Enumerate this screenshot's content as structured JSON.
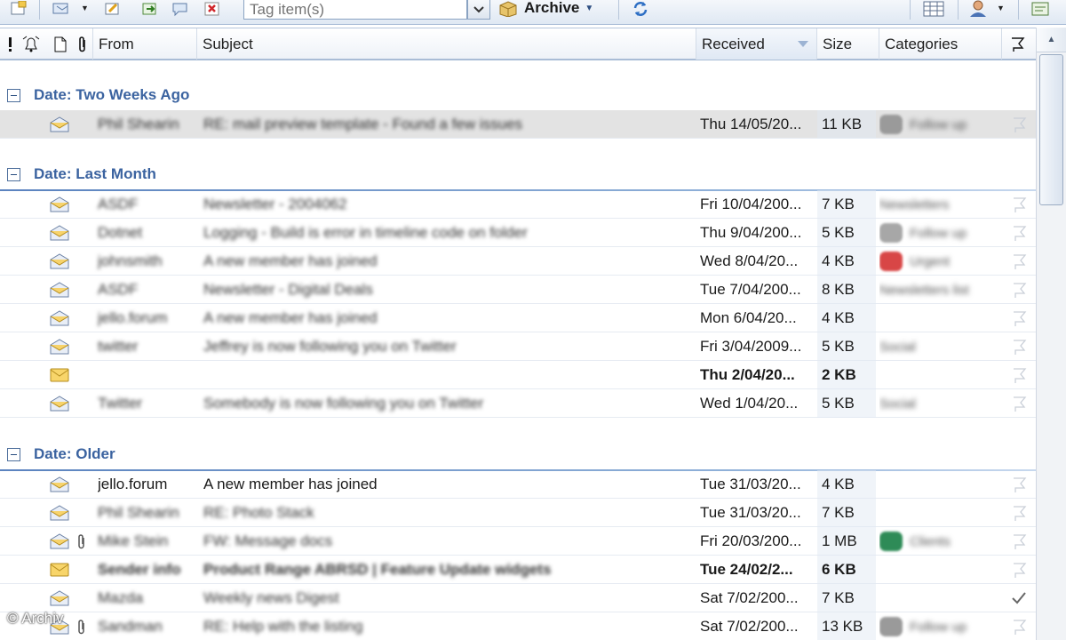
{
  "toolbar": {
    "tag_placeholder": "Tag item(s)",
    "archive_label": "Archive"
  },
  "columns": {
    "from": "From",
    "subject": "Subject",
    "received": "Received",
    "size": "Size",
    "categories": "Categories"
  },
  "groups": [
    {
      "label": "Date: Two Weeks Ago"
    },
    {
      "label": "Date: Last Month"
    },
    {
      "label": "Date: Older"
    }
  ],
  "rows": [
    {
      "from": "Phil Shearin",
      "subject": "RE: mail preview template - Found a few issues",
      "received": "Thu 14/05/20...",
      "size": "11 KB",
      "category": "Follow up",
      "cat_color": "#9a9a9a",
      "flag": "flag",
      "attach": false,
      "read": true,
      "selected": true,
      "blurred": true
    },
    {
      "from": "ASDF",
      "subject": "Newsletter - 2004062",
      "received": "Fri 10/04/200...",
      "size": "7 KB",
      "category": "Newsletters",
      "cat_color": "",
      "flag": "flag",
      "attach": false,
      "read": true,
      "blurred": true
    },
    {
      "from": "Dotnet",
      "subject": "Logging - Build is error in timeline code on folder",
      "received": "Thu 9/04/200...",
      "size": "5 KB",
      "category": "Follow up",
      "cat_color": "#a7a7a7",
      "flag": "flag",
      "attach": false,
      "read": true,
      "blurred": true
    },
    {
      "from": "johnsmith",
      "subject": "A new member has joined",
      "received": "Wed 8/04/20...",
      "size": "4 KB",
      "category": "Urgent",
      "cat_color": "#d84646",
      "flag": "flag",
      "attach": false,
      "read": true,
      "blurred": true
    },
    {
      "from": "ASDF",
      "subject": "Newsletter - Digital Deals",
      "received": "Tue 7/04/200...",
      "size": "8 KB",
      "category": "Newsletters list",
      "cat_color": "",
      "flag": "flag",
      "attach": false,
      "read": true,
      "blurred": true
    },
    {
      "from": "jello.forum",
      "subject": "A new member has joined",
      "received": "Mon 6/04/20...",
      "size": "4 KB",
      "category": "",
      "cat_color": "",
      "flag": "flag",
      "attach": false,
      "read": true,
      "blurred": true
    },
    {
      "from": "twitter",
      "subject": "Jeffrey is now following you on Twitter",
      "received": "Fri 3/04/2009...",
      "size": "5 KB",
      "category": "Social",
      "cat_color": "",
      "flag": "flag",
      "attach": false,
      "read": true,
      "blurred": true
    },
    {
      "from": "",
      "subject": "",
      "received": "Thu 2/04/20...",
      "size": "2 KB",
      "category": "",
      "cat_color": "",
      "flag": "flag",
      "attach": false,
      "read": false,
      "bold": true,
      "blurred": false
    },
    {
      "from": "Twitter",
      "subject": "Somebody is now following you on Twitter",
      "received": "Wed 1/04/20...",
      "size": "5 KB",
      "category": "Social",
      "cat_color": "",
      "flag": "flag",
      "attach": false,
      "read": true,
      "blurred": true
    },
    {
      "from": "jello.forum",
      "subject": "A new member has joined",
      "received": "Tue 31/03/20...",
      "size": "4 KB",
      "category": "",
      "cat_color": "",
      "flag": "flag",
      "attach": false,
      "read": true,
      "blurred": false
    },
    {
      "from": "Phil Shearin",
      "subject": "RE: Photo Stack",
      "received": "Tue 31/03/20...",
      "size": "7 KB",
      "category": "",
      "cat_color": "",
      "flag": "flag",
      "attach": false,
      "read": true,
      "blurred": true
    },
    {
      "from": "Mike Stein",
      "subject": "FW: Message docs",
      "received": "Fri 20/03/200...",
      "size": "1 MB",
      "category": "Clients",
      "cat_color": "#2e8b57",
      "flag": "flag",
      "attach": true,
      "read": true,
      "blurred": true
    },
    {
      "from": "Sender info",
      "subject": "Product Range ABRSD | Feature Update widgets",
      "received": "Tue 24/02/2...",
      "size": "6 KB",
      "category": "",
      "cat_color": "",
      "flag": "flag",
      "attach": false,
      "read": false,
      "bold": true,
      "blurred": true
    },
    {
      "from": "Mazda",
      "subject": "Weekly news Digest",
      "received": "Sat 7/02/200...",
      "size": "7 KB",
      "category": "",
      "cat_color": "",
      "flag": "check",
      "attach": false,
      "read": true,
      "blurred": true
    },
    {
      "from": "Sandman",
      "subject": "RE: Help with the listing",
      "received": "Sat 7/02/200...",
      "size": "13 KB",
      "category": "Follow up",
      "cat_color": "#9a9a9a",
      "flag": "flag",
      "attach": true,
      "read": true,
      "blurred": true
    }
  ],
  "watermark": "© Archiv",
  "colors": {
    "group_text": "#3b63a0",
    "selected_row": "#e3e3e3",
    "accent_line": "#5b83bf"
  },
  "icons": [
    "new-item-icon",
    "reply-icon",
    "forward-icon",
    "move-icon",
    "chat-icon",
    "delete-icon",
    "archive-box-icon",
    "send-receive-icon",
    "calendar-grid-icon",
    "contacts-icon",
    "notes-icon"
  ]
}
